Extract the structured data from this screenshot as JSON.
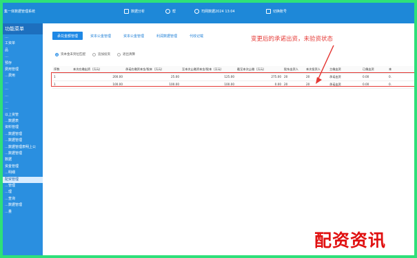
{
  "topbar": {
    "system_name": "集一体数据管理系统",
    "items": [
      {
        "label": "数据分析",
        "icon": "home-icon"
      },
      {
        "label": "帮",
        "icon": "help-icon"
      },
      {
        "label": "司网数据2024 13:04",
        "icon": "clock-icon"
      },
      {
        "label": "切换账号",
        "icon": "logout-icon"
      }
    ]
  },
  "sidebar": {
    "title": "功能菜单",
    "items": [
      "…",
      "工资单",
      "品",
      "…",
      "预存",
      "费用管理",
      "…费用",
      "…",
      "…",
      "…",
      "…",
      "…",
      "以上资管",
      "…数据表",
      "资料管理",
      "…数据管理",
      "…数据管理",
      "…数据管理表明上公",
      "…数据管理",
      "数据",
      "资金管理",
      "…明细",
      "配资管理",
      "…管理",
      "…理",
      "…查询",
      "…数据管理",
      "…量"
    ],
    "active_index": 22
  },
  "tabs": [
    {
      "label": "承兑金额管理",
      "active": true
    },
    {
      "label": "资本公金管理",
      "active": false
    },
    {
      "label": "资本公金管理",
      "active": false
    },
    {
      "label": "利润数据管理",
      "active": false
    },
    {
      "label": "代收记载",
      "active": false
    }
  ],
  "radios": [
    {
      "label": "资本金未到位匹配",
      "checked": true
    },
    {
      "label": "追加投资",
      "checked": false
    },
    {
      "label": "退出清算",
      "checked": false
    }
  ],
  "annotation": "变更后的承诺出资，未验资状态",
  "table": {
    "columns": [
      "序数",
      "本次应缴出资（万元）",
      "承诺应缴资本金/股本（万元）",
      "至本次止缴资本金/股本（万元）",
      "截至本次止缴（万元）",
      "股东出资人",
      "本次投资人",
      "主缴出资",
      "已缴出资",
      "本"
    ],
    "rows": [
      [
        "1",
        "200.00",
        "25.00",
        "125.00",
        "275.00",
        "20",
        "20",
        "承诺出资",
        "0.00",
        "0."
      ],
      [
        "1",
        "100.00",
        "100.00",
        "100.00",
        "0.00",
        "20",
        "20",
        "承诺出资",
        "0.00",
        "0."
      ]
    ]
  },
  "watermark": "配资资讯",
  "colors": {
    "accent": "#1e88e5",
    "annotation": "#e53935",
    "frame": "#2ee07a"
  }
}
